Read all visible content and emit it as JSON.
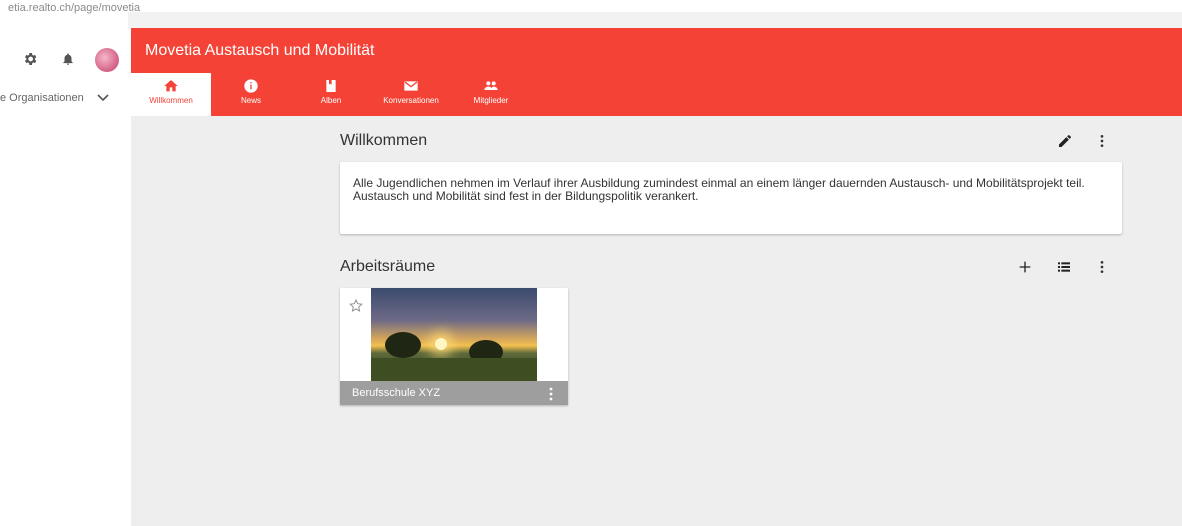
{
  "browser": {
    "url": "etia.realto.ch/page/movetia"
  },
  "sidebar": {
    "organizations_label": "e Organisationen"
  },
  "header": {
    "title": "Movetia Austausch und Mobilität",
    "tabs": [
      {
        "label": "Willkommen",
        "icon": "home-icon",
        "active": true
      },
      {
        "label": "News",
        "icon": "info-icon",
        "active": false
      },
      {
        "label": "Alben",
        "icon": "album-icon",
        "active": false
      },
      {
        "label": "Konversationen",
        "icon": "mail-icon",
        "active": false
      },
      {
        "label": "Mitglieder",
        "icon": "people-icon",
        "active": false
      }
    ]
  },
  "welcome": {
    "title": "Willkommen",
    "text": "Alle Jugendlichen nehmen im Verlauf ihrer Ausbildung zumindest einmal an einem länger dauernden Austausch- und Mobilitätsprojekt teil. Austausch und Mobilität sind fest in der Bildungspolitik verankert."
  },
  "workspaces": {
    "title": "Arbeitsräume",
    "items": [
      {
        "name": "Berufsschule XYZ"
      }
    ]
  },
  "colors": {
    "accent": "#f44336",
    "background": "#eeeeee"
  }
}
